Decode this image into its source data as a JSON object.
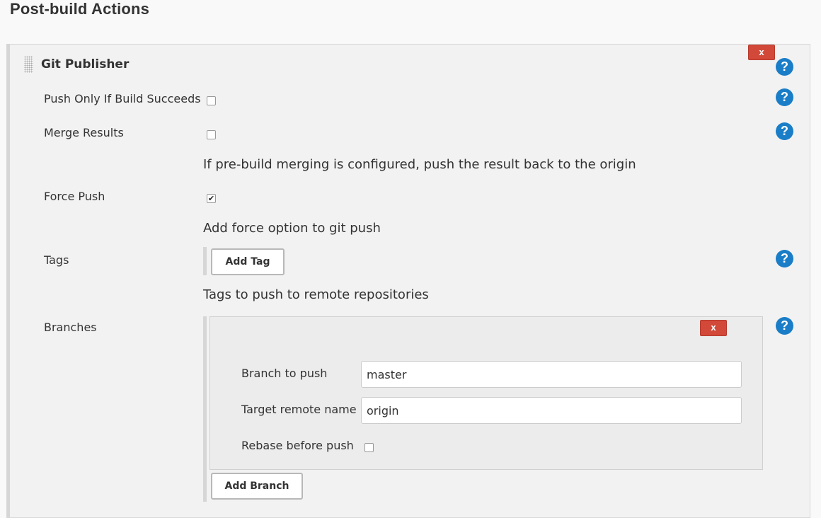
{
  "section_title": "Post-build Actions",
  "publisher": {
    "title": "Git Publisher",
    "delete_label": "x",
    "help_label": "?",
    "fields": {
      "push_only_label": "Push Only If Build Succeeds",
      "push_only_checked": false,
      "merge_results_label": "Merge Results",
      "merge_results_checked": false,
      "merge_results_desc": "If pre-build merging is configured, push the result back to the origin",
      "force_push_label": "Force Push",
      "force_push_checked": true,
      "force_push_desc": "Add force option to git push",
      "tags_label": "Tags",
      "add_tag_label": "Add Tag",
      "tags_desc": "Tags to push to remote repositories",
      "branches_label": "Branches",
      "add_branch_label": "Add Branch"
    },
    "branch": {
      "delete_label": "x",
      "branch_to_push_label": "Branch to push",
      "branch_to_push_value": "master",
      "target_remote_label": "Target remote name",
      "target_remote_value": "origin",
      "rebase_label": "Rebase before push",
      "rebase_checked": false
    }
  },
  "colors": {
    "help_blue": "#1a7dc7",
    "delete_red": "#d24939"
  },
  "icons": {
    "help": "question-circle-icon",
    "drag": "drag-handle-icon",
    "check": "check-mark-icon"
  }
}
